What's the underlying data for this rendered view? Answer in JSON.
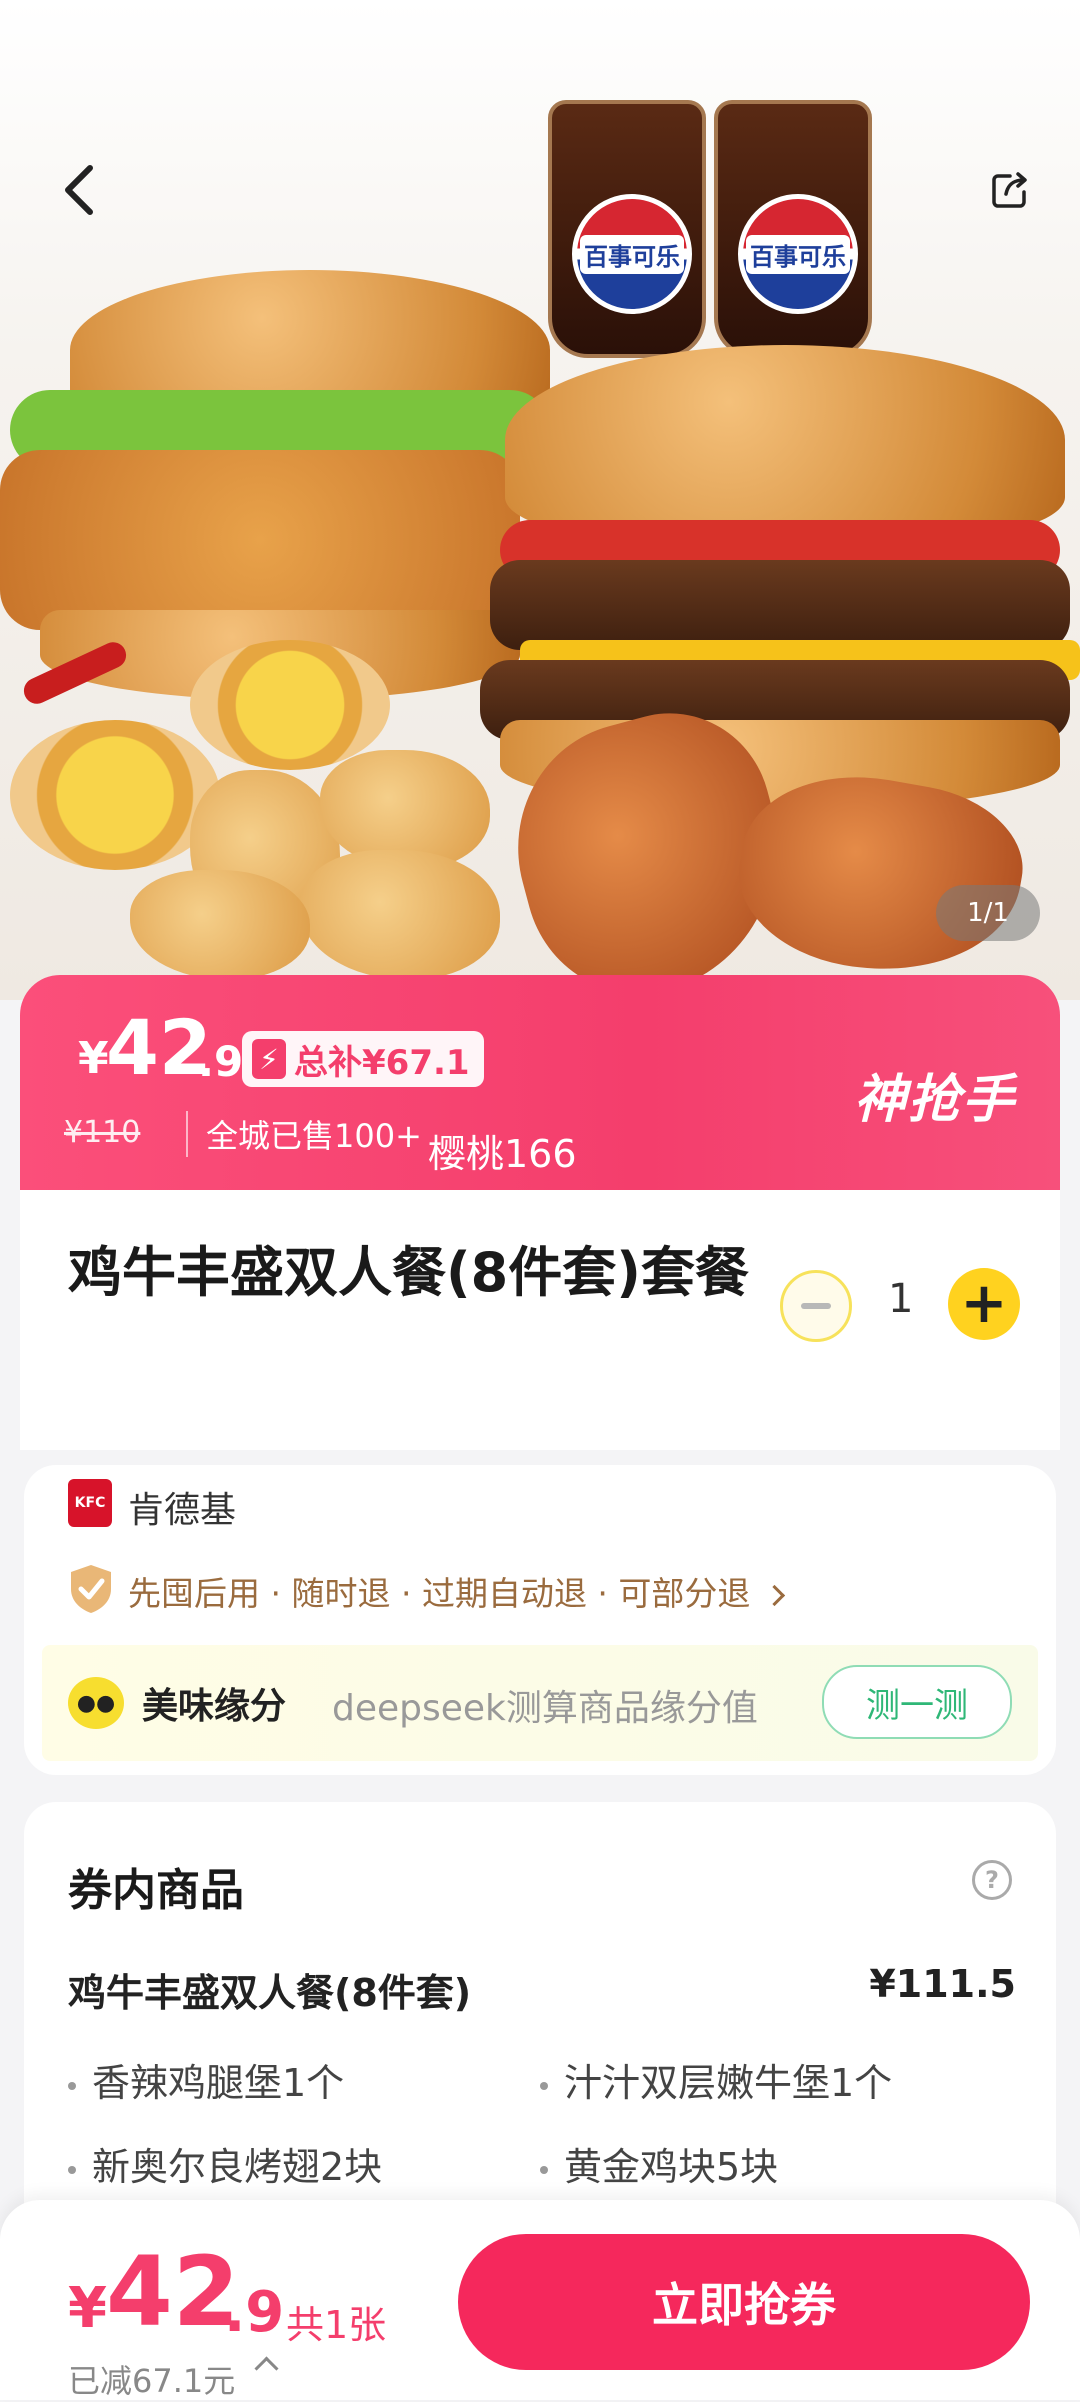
{
  "nav": {
    "back_icon": "chevron-left-icon",
    "share_icon": "share-icon"
  },
  "gallery": {
    "pager": "1/1",
    "pepsi_text": "百事可乐"
  },
  "price_banner": {
    "currency": "¥",
    "price_integer": "42",
    "price_decimal": ".9",
    "subsidy_label": "总补¥67.1",
    "original_price": "¥110",
    "sold_text": "全城已售100+",
    "username": "樱桃166",
    "brand": "神抢手",
    "colors": {
      "banner": "#f43e6c",
      "accent": "#ffffff"
    }
  },
  "product": {
    "title": "鸡牛丰盛双人餐(8件套)套餐",
    "quantity": "1"
  },
  "merchant": {
    "logo_text": "KFC",
    "name": "肯德基",
    "policy": "先囤后用 · 随时退 · 过期自动退 · 可部分退",
    "yuanfen": {
      "title": "美味缘分",
      "description": "deepseek测算商品缘分值",
      "button": "测一测"
    }
  },
  "coupon_items": {
    "title": "券内商品",
    "combo_name": "鸡牛丰盛双人餐(8件套)",
    "combo_price": "¥111.5",
    "items": [
      "香辣鸡腿堡1个",
      "汁汁双层嫩牛堡1个",
      "新奥尔良烤翅2块",
      "黄金鸡块5块"
    ]
  },
  "bottom_bar": {
    "currency": "¥",
    "price_integer": "42",
    "price_decimal": ".9",
    "count_text": "共1张",
    "saved_text": "已减67.1元",
    "buy_button": "立即抢券",
    "colors": {
      "primary": "#f5285c"
    }
  }
}
